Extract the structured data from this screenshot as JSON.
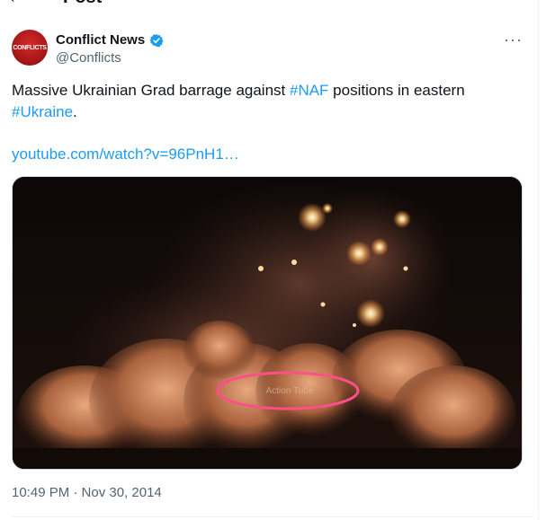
{
  "header": {
    "back_icon": "arrow-left-icon",
    "title": "Post"
  },
  "author": {
    "name": "Conflict News",
    "handle": "@Conflicts",
    "avatar_text": "CONFLICTS",
    "verified_icon": "verified-badge-icon",
    "brand_color": "#1d9bf0"
  },
  "more_label": "···",
  "tweet": {
    "text_part1": "Massive Ukrainian Grad barrage against ",
    "hashtag1": "#NAF",
    "text_part2": " positions in eastern ",
    "hashtag2": "#Ukraine",
    "text_part3": ".",
    "link": "youtube.com/watch?v=96PnH1…"
  },
  "media": {
    "watermark": "Action Tube"
  },
  "timestamp": "10:49 PM · Nov 30, 2014"
}
